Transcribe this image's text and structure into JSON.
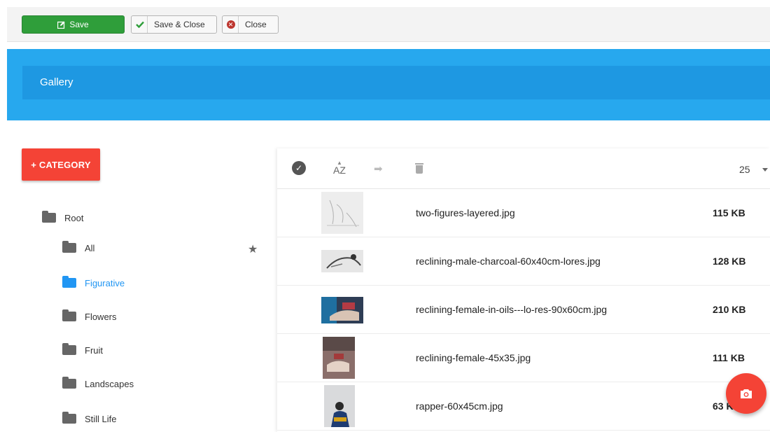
{
  "toolbar": {
    "save_label": "Save",
    "save_close_label": "Save & Close",
    "close_label": "Close"
  },
  "header": {
    "title": "Gallery"
  },
  "sidebar": {
    "add_category_label": "+ CATEGORY",
    "items": [
      {
        "label": "Root",
        "active": false
      },
      {
        "label": "All",
        "active": false,
        "starred": true
      },
      {
        "label": "Figurative",
        "active": true
      },
      {
        "label": "Flowers",
        "active": false
      },
      {
        "label": "Fruit",
        "active": false
      },
      {
        "label": "Landscapes",
        "active": false
      },
      {
        "label": "Still Life",
        "active": false
      }
    ]
  },
  "panel": {
    "toolbar": {
      "sort_icon_text": "AZ",
      "page_size": "25"
    },
    "files": [
      {
        "name": "two-figures-layered.jpg",
        "size": "115 KB"
      },
      {
        "name": "reclining-male-charcoal-60x40cm-lores.jpg",
        "size": "128 KB"
      },
      {
        "name": "reclining-female-in-oils---lo-res-90x60cm.jpg",
        "size": "210 KB"
      },
      {
        "name": "reclining-female-45x35.jpg",
        "size": "111 KB"
      },
      {
        "name": "rapper-60x45cm.jpg",
        "size": "63 KB"
      }
    ]
  },
  "colors": {
    "header_bg": "#27a8ee",
    "save_green": "#2f9e3a",
    "accent_red": "#f44336",
    "active_blue": "#2196f3"
  },
  "icons": {
    "save": "edit-icon",
    "save_close": "check-icon",
    "close": "x-circle-icon",
    "select_all": "check-circle-icon",
    "sort": "sort-az-icon",
    "move": "arrow-right-icon",
    "delete": "trash-icon",
    "upload": "camera-icon"
  }
}
